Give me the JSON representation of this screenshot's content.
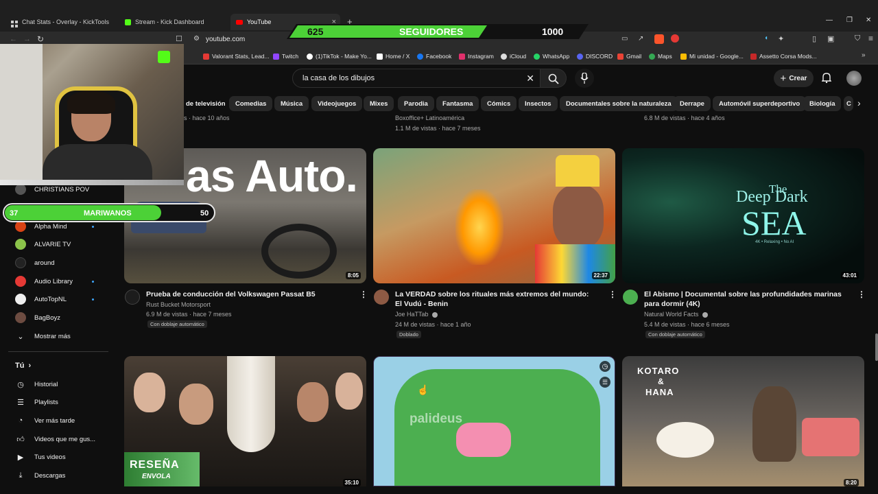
{
  "browser": {
    "tabs": [
      {
        "label": "Chat Stats - Overlay - KickTools"
      },
      {
        "label": "Stream - Kick Dashboard"
      },
      {
        "label": "YouTube"
      }
    ],
    "url": "youtube.com",
    "bookmarks": [
      {
        "label": "Valorant Stats, Lead...",
        "color": "#e53935"
      },
      {
        "label": "Twitch",
        "color": "#9146ff"
      },
      {
        "label": "(1)TikTok - Make Yo...",
        "color": "#ffffff"
      },
      {
        "label": "Home / X",
        "color": "#ffffff"
      },
      {
        "label": "Facebook",
        "color": "#1877f2"
      },
      {
        "label": "Instagram",
        "color": "#e1306c"
      },
      {
        "label": "iCloud",
        "color": "#dddddd"
      },
      {
        "label": "WhatsApp",
        "color": "#25d366"
      },
      {
        "label": "DISCORD",
        "color": "#5865f2"
      },
      {
        "label": "Gmail",
        "color": "#ea4335"
      },
      {
        "label": "Maps",
        "color": "#34a853"
      },
      {
        "label": "Mi unidad - Google...",
        "color": "#fbbc04"
      },
      {
        "label": "Assetto Corsa Mods...",
        "color": "#c62828"
      }
    ]
  },
  "overlay": {
    "followers_current": "625",
    "followers_label": "SEGUIDORES",
    "followers_goal": "1000",
    "bar_current": "37",
    "bar_label": "MARIWANOS",
    "bar_goal": "50"
  },
  "search": {
    "query": "la casa de los dibujos"
  },
  "header": {
    "create_label": "Crear"
  },
  "chips": [
    "de televisión",
    "Comedias",
    "Música",
    "Videojuegos",
    "Mixes",
    "Parodia",
    "Fantasma",
    "Cómics",
    "Insectos",
    "Documentales sobre la naturaleza",
    "Derrape",
    "Automóvil superdeportivo",
    "Biología",
    "C"
  ],
  "sidebar": {
    "subscriptions": [
      {
        "label": "CHRISTIANS POV",
        "color": "#555555"
      },
      {
        "label": "Alpha Mind",
        "color": "#d84315"
      },
      {
        "label": "ALVARIE TV",
        "color": "#8bc34a"
      },
      {
        "label": "around",
        "color": "#222222"
      },
      {
        "label": "Audio Library",
        "color": "#e53935"
      },
      {
        "label": "AutoTopNL",
        "color": "#eeeeee"
      },
      {
        "label": "BagBoyz",
        "color": "#6d4c41"
      }
    ],
    "show_more": "Mostrar más",
    "you_header": "Tú",
    "you_items": [
      "Historial",
      "Playlists",
      "Ver más tarde",
      "Videos que me gus...",
      "Tus videos",
      "Descargas"
    ]
  },
  "top_row_meta": [
    "s · hace 10 años",
    "Boxoffice+ Latinoamérica",
    "1.1 M de vistas · hace 7 meses",
    "6.8 M de vistas · hace 4 años"
  ],
  "videos": [
    {
      "thumb_text": "as Auto.",
      "duration": "8:05",
      "title": "Prueba de conducción del Volkswagen Passat B5",
      "channel": "Rust Bucket Motorsport",
      "stats": "6.9 M de vistas · hace 7 meses",
      "badge": "Con doblaje automático",
      "channel_color": "#222222"
    },
    {
      "thumb_text": "",
      "duration": "22:37",
      "title": "La VERDAD sobre los rituales más extremos del mundo: El Vudú - Benin",
      "channel": "Joe HaTTab",
      "stats": "24 M de vistas · hace 1 año",
      "badge": "Doblado",
      "channel_color": "#8d5a44"
    },
    {
      "thumb_text_1": "The",
      "thumb_text_2": "Deep Dark",
      "thumb_text_3": "SEA",
      "thumb_text_4": "4K • Relaxing • No AI",
      "duration": "43:01",
      "title": "El Abismo | Documental sobre las profundidades marinas para dormir (4K)",
      "channel": "Natural World Facts",
      "stats": "5.4 M de vistas · hace 6 meses",
      "badge": "Con doblaje automático",
      "channel_color": "#4caf50"
    },
    {
      "thumb_text_1": "RESEÑA",
      "thumb_text_2": "ENVOLA",
      "duration": "35:10"
    },
    {
      "watermark": "palideus"
    },
    {
      "thumb_text_1": "KOTARO",
      "thumb_text_2": "&",
      "thumb_text_3": "HANA",
      "duration": "8:20"
    }
  ]
}
